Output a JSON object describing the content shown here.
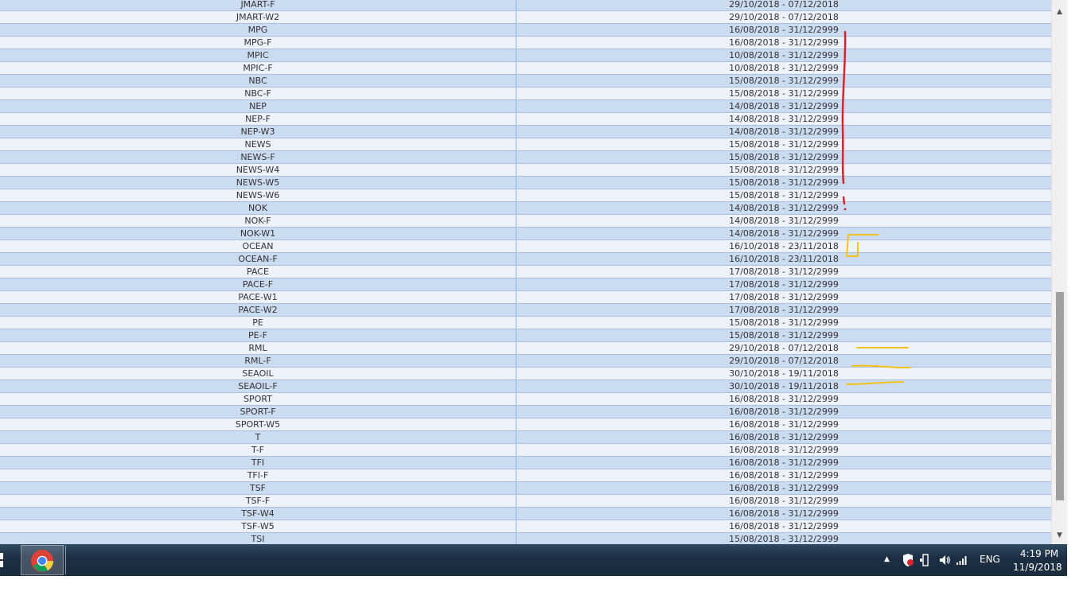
{
  "table": {
    "rows": [
      {
        "name": "JMART-F",
        "range": "29/10/2018 - 07/12/2018"
      },
      {
        "name": "JMART-W2",
        "range": "29/10/2018 - 07/12/2018"
      },
      {
        "name": "MPG",
        "range": "16/08/2018 - 31/12/2999"
      },
      {
        "name": "MPG-F",
        "range": "16/08/2018 - 31/12/2999"
      },
      {
        "name": "MPIC",
        "range": "10/08/2018 - 31/12/2999"
      },
      {
        "name": "MPIC-F",
        "range": "10/08/2018 - 31/12/2999"
      },
      {
        "name": "NBC",
        "range": "15/08/2018 - 31/12/2999"
      },
      {
        "name": "NBC-F",
        "range": "15/08/2018 - 31/12/2999"
      },
      {
        "name": "NEP",
        "range": "14/08/2018 - 31/12/2999"
      },
      {
        "name": "NEP-F",
        "range": "14/08/2018 - 31/12/2999"
      },
      {
        "name": "NEP-W3",
        "range": "14/08/2018 - 31/12/2999"
      },
      {
        "name": "NEWS",
        "range": "15/08/2018 - 31/12/2999"
      },
      {
        "name": "NEWS-F",
        "range": "15/08/2018 - 31/12/2999"
      },
      {
        "name": "NEWS-W4",
        "range": "15/08/2018 - 31/12/2999"
      },
      {
        "name": "NEWS-W5",
        "range": "15/08/2018 - 31/12/2999"
      },
      {
        "name": "NEWS-W6",
        "range": "15/08/2018 - 31/12/2999"
      },
      {
        "name": "NOK",
        "range": "14/08/2018 - 31/12/2999"
      },
      {
        "name": "NOK-F",
        "range": "14/08/2018 - 31/12/2999"
      },
      {
        "name": "NOK-W1",
        "range": "14/08/2018 - 31/12/2999"
      },
      {
        "name": "OCEAN",
        "range": "16/10/2018 - 23/11/2018"
      },
      {
        "name": "OCEAN-F",
        "range": "16/10/2018 - 23/11/2018"
      },
      {
        "name": "PACE",
        "range": "17/08/2018 - 31/12/2999"
      },
      {
        "name": "PACE-F",
        "range": "17/08/2018 - 31/12/2999"
      },
      {
        "name": "PACE-W1",
        "range": "17/08/2018 - 31/12/2999"
      },
      {
        "name": "PACE-W2",
        "range": "17/08/2018 - 31/12/2999"
      },
      {
        "name": "PE",
        "range": "15/08/2018 - 31/12/2999"
      },
      {
        "name": "PE-F",
        "range": "15/08/2018 - 31/12/2999"
      },
      {
        "name": "RML",
        "range": "29/10/2018 - 07/12/2018"
      },
      {
        "name": "RML-F",
        "range": "29/10/2018 - 07/12/2018"
      },
      {
        "name": "SEAOIL",
        "range": "30/10/2018 - 19/11/2018"
      },
      {
        "name": "SEAOIL-F",
        "range": "30/10/2018 - 19/11/2018"
      },
      {
        "name": "SPORT",
        "range": "16/08/2018 - 31/12/2999"
      },
      {
        "name": "SPORT-F",
        "range": "16/08/2018 - 31/12/2999"
      },
      {
        "name": "SPORT-W5",
        "range": "16/08/2018 - 31/12/2999"
      },
      {
        "name": "T",
        "range": "16/08/2018 - 31/12/2999"
      },
      {
        "name": "T-F",
        "range": "16/08/2018 - 31/12/2999"
      },
      {
        "name": "TFI",
        "range": "16/08/2018 - 31/12/2999"
      },
      {
        "name": "TFI-F",
        "range": "16/08/2018 - 31/12/2999"
      },
      {
        "name": "TSF",
        "range": "16/08/2018 - 31/12/2999"
      },
      {
        "name": "TSF-F",
        "range": "16/08/2018 - 31/12/2999"
      },
      {
        "name": "TSF-W4",
        "range": "16/08/2018 - 31/12/2999"
      },
      {
        "name": "TSF-W5",
        "range": "16/08/2018 - 31/12/2999"
      },
      {
        "name": "TSI",
        "range": "15/08/2018 - 31/12/2999"
      }
    ]
  },
  "scrollbar": {
    "up_glyph": "▲",
    "down_glyph": "▼"
  },
  "taskbar": {
    "pinned": [
      {
        "name": "chrome-icon"
      }
    ],
    "tray": {
      "overflow_glyph": "▲",
      "language": "ENG",
      "time": "4:19 PM",
      "date": "11/9/2018"
    }
  },
  "colors": {
    "row_odd": "#ccdcf0",
    "row_even": "#eef3fb",
    "annotation_red": "#d9232d",
    "annotation_yellow": "#f2c21b"
  }
}
